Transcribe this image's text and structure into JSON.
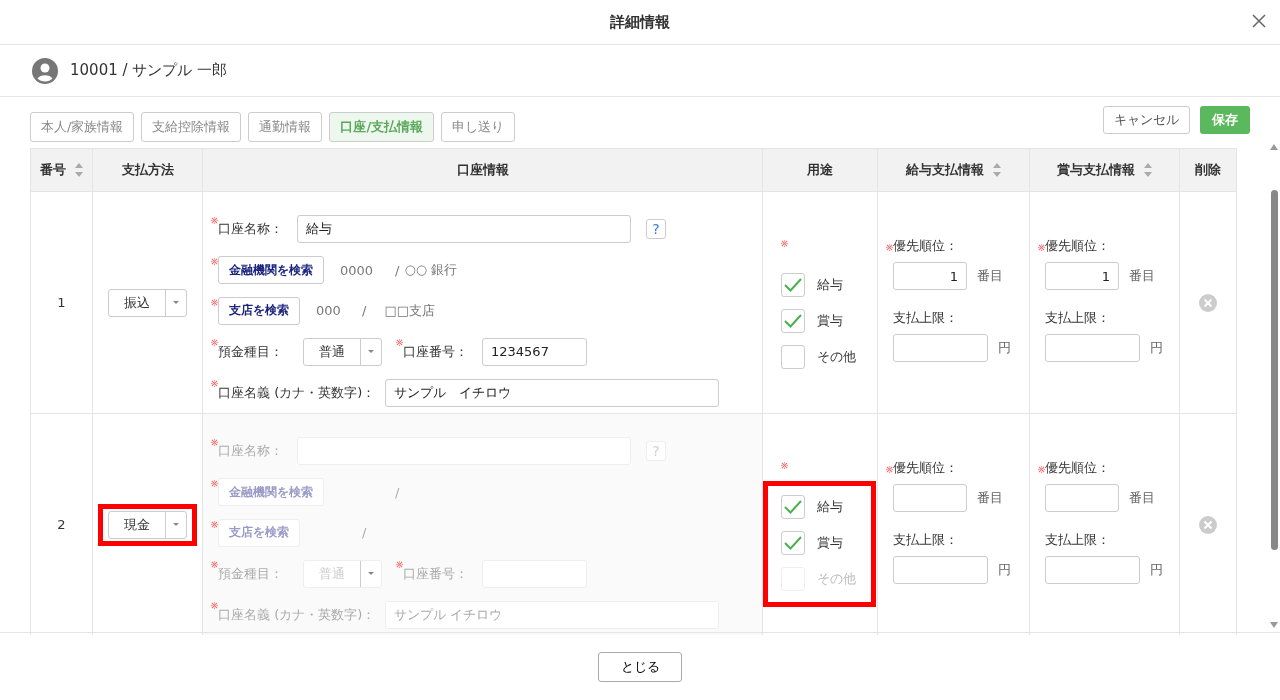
{
  "dialog": {
    "title": "詳細情報"
  },
  "employee": {
    "label": "10001 / サンプル 一郎"
  },
  "tabs": [
    {
      "label": "本人/家族情報",
      "selected": false
    },
    {
      "label": "支給控除情報",
      "selected": false
    },
    {
      "label": "通勤情報",
      "selected": false
    },
    {
      "label": "口座/支払情報",
      "selected": true
    },
    {
      "label": "申し送り",
      "selected": false
    }
  ],
  "actions": {
    "cancel": "キャンセル",
    "save": "保存"
  },
  "table": {
    "columns": [
      {
        "label": "番号",
        "sortable": true
      },
      {
        "label": "支払方法",
        "sortable": false
      },
      {
        "label": "口座情報",
        "sortable": false
      },
      {
        "label": "用途",
        "sortable": false
      },
      {
        "label": "給与支払情報",
        "sortable": true
      },
      {
        "label": "賞与支払情報",
        "sortable": true
      },
      {
        "label": "削除",
        "sortable": false
      }
    ],
    "rows": [
      {
        "number": "1",
        "disabled": false,
        "payment": {
          "value": "振込",
          "highlighted": false
        },
        "account": {
          "name_label": {
            "text": "口座名称：",
            "required": true
          },
          "name_value": "給与",
          "help": "?",
          "bank_button": {
            "text": "金融機関を検索",
            "required": true
          },
          "bank_code": "0000",
          "bank_separator": "/",
          "bank_name": "○○ 銀行",
          "branch_button": {
            "text": "支店を検索",
            "required": true
          },
          "branch_code": "000",
          "branch_separator": "/",
          "branch_name": "□□支店",
          "type_label": {
            "text": "預金種目：",
            "required": true
          },
          "type_value": "普通",
          "number_label": {
            "text": "口座番号：",
            "required": true
          },
          "number_value": "1234567",
          "holder_label": {
            "text": "口座名義 (カナ・英数字)：",
            "required": true
          },
          "holder_value": "サンプル　イチロウ"
        },
        "usage": {
          "required": true,
          "highlighted": false,
          "options": [
            {
              "label": "給与",
              "checked": true,
              "disabled": false
            },
            {
              "label": "賞与",
              "checked": true,
              "disabled": false
            },
            {
              "label": "その他",
              "checked": false,
              "disabled": false
            }
          ]
        },
        "salary": {
          "priority_label": {
            "text": "優先順位：",
            "required": true
          },
          "priority_value": "1",
          "priority_unit": "番目",
          "limit_label": {
            "text": "支払上限：",
            "required": false
          },
          "limit_unit": "円"
        },
        "bonus": {
          "priority_label": {
            "text": "優先順位：",
            "required": true
          },
          "priority_value": "1",
          "priority_unit": "番目",
          "limit_label": {
            "text": "支払上限：",
            "required": false
          },
          "limit_unit": "円"
        }
      },
      {
        "number": "2",
        "disabled": true,
        "payment": {
          "value": "現金",
          "highlighted": true
        },
        "account": {
          "name_label": {
            "text": "口座名称：",
            "required": true
          },
          "help": "?",
          "bank_button": {
            "text": "金融機関を検索",
            "required": true
          },
          "bank_separator": "/",
          "branch_button": {
            "text": "支店を検索",
            "required": true
          },
          "branch_separator": "/",
          "type_label": {
            "text": "預金種目：",
            "required": true
          },
          "type_value": "普通",
          "number_label": {
            "text": "口座番号：",
            "required": true
          },
          "holder_label": {
            "text": "口座名義 (カナ・英数字)：",
            "required": true
          },
          "holder_placeholder": "サンプル イチロウ"
        },
        "usage": {
          "required": true,
          "highlighted": true,
          "options": [
            {
              "label": "給与",
              "checked": true,
              "disabled": false
            },
            {
              "label": "賞与",
              "checked": true,
              "disabled": false
            },
            {
              "label": "その他",
              "checked": false,
              "disabled": true
            }
          ]
        },
        "salary": {
          "priority_label": {
            "text": "優先順位：",
            "required": true
          },
          "priority_unit": "番目",
          "limit_label": {
            "text": "支払上限：",
            "required": false
          },
          "limit_unit": "円"
        },
        "bonus": {
          "priority_label": {
            "text": "優先順位：",
            "required": true
          },
          "priority_unit": "番目",
          "limit_label": {
            "text": "支払上限：",
            "required": false
          },
          "limit_unit": "円"
        }
      }
    ]
  },
  "footer": {
    "close": "とじる"
  }
}
